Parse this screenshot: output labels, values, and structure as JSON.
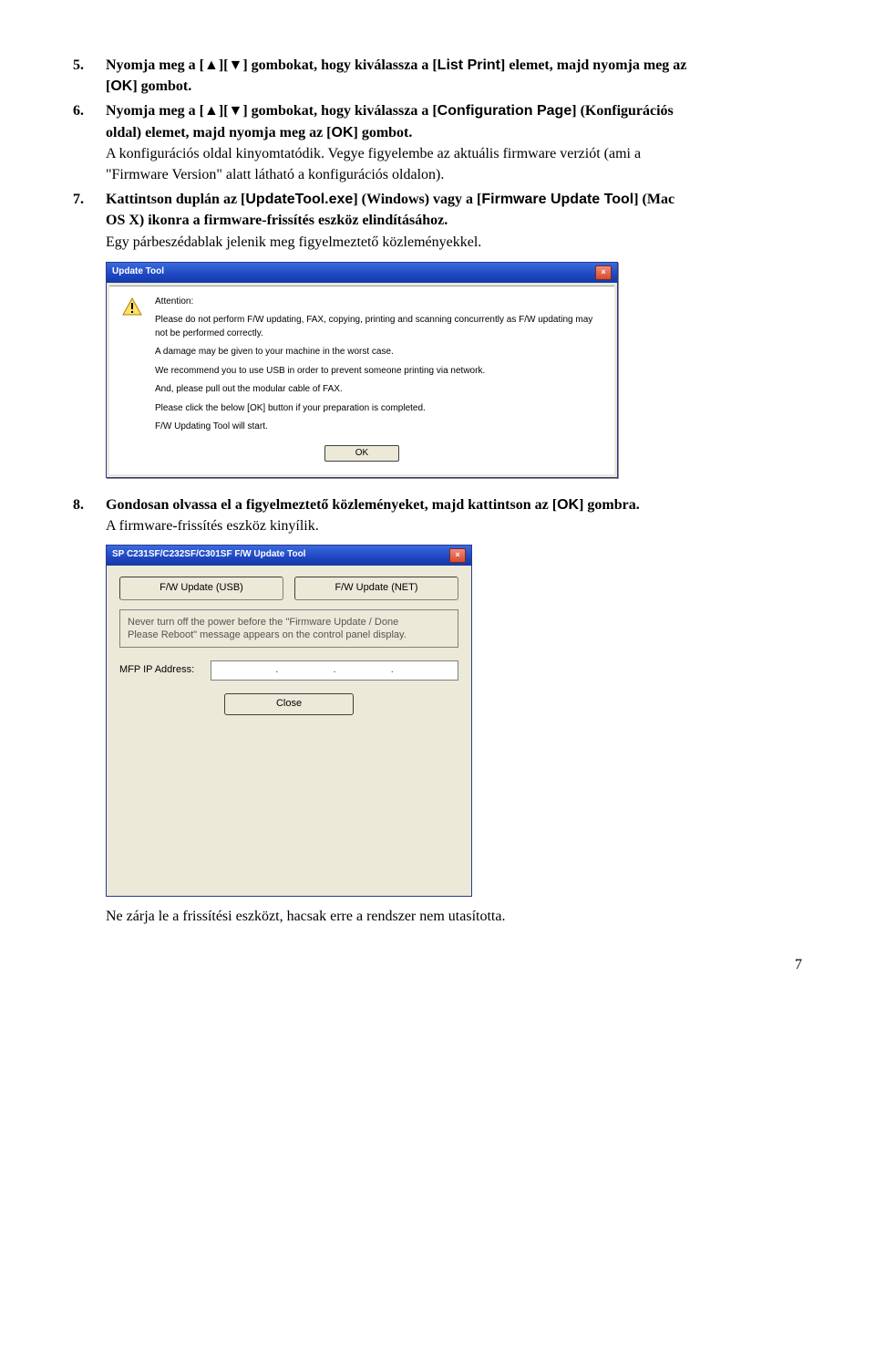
{
  "steps": {
    "s5": {
      "num": "5.",
      "pre": "Nyomja meg a [",
      "up": "▲",
      "mid1": "][",
      "down": "▼",
      "mid2": "] gombokat, hogy kiválassza a [",
      "listprint": "List Print",
      "mid3": "] elemet, majd nyomja meg az",
      "line2a": "[",
      "ok": "OK",
      "line2b": "] gombot."
    },
    "s6": {
      "num": "6.",
      "pre": "Nyomja meg a [",
      "up": "▲",
      "mid1": "][",
      "down": "▼",
      "mid2": "] gombokat, hogy kiválassza a [",
      "cfg": "Configuration Page",
      "mid3": "] (Konfigurációs",
      "line2a": "oldal) elemet, majd nyomja meg az [",
      "ok": "OK",
      "line2b": "] gombot.",
      "p1": "A konfigurációs oldal kinyomtatódik. Vegye figyelembe az aktuális firmware verziót (ami a",
      "p2": "\"Firmware Version\" alatt látható a konfigurációs oldalon)."
    },
    "s7": {
      "num": "7.",
      "pre": "Kattintson duplán az [",
      "exe": "UpdateTool.exe",
      "mid1": "] (Windows) vagy a [",
      "tool": "Firmware Update Tool",
      "mid2": "] (Mac",
      "line2": "OS X) ikonra a firmware-frissítés eszköz elindításához.",
      "p1": "Egy párbeszédablak jelenik meg figyelmeztető közleményekkel."
    },
    "s8": {
      "num": "8.",
      "pre": "Gondosan olvassa el a figyelmeztető közleményeket, majd kattintson az [",
      "ok": "OK",
      "post": "] gombra.",
      "p1": "A firmware-frissítés eszköz kinyílik."
    }
  },
  "dialog1": {
    "title": "Update Tool",
    "close_x": "×",
    "attention": "Attention:",
    "m1": "Please do not perform F/W updating, FAX, copying, printing and scanning concurrently as F/W updating may not be performed correctly.",
    "m2": "A damage may be given to your machine in the worst case.",
    "m3": "We recommend you to use USB in order to prevent someone printing via network.",
    "m4": "And, please pull out the modular cable of FAX.",
    "m5": "Please click the below [OK] button if your preparation is completed.",
    "m6": "F/W Updating Tool will start.",
    "ok": "OK"
  },
  "dialog2": {
    "title": "SP C231SF/C232SF/C301SF F/W Update Tool",
    "close_x": "×",
    "btn_usb": "F/W Update (USB)",
    "btn_net": "F/W Update (NET)",
    "notice1": "Never turn off the power before the \"Firmware Update / Done",
    "notice2": "Please Reboot\" message appears on the control panel display.",
    "ip_label": "MFP IP Address:",
    "dot": ".",
    "close": "Close"
  },
  "footer": {
    "note": "Ne zárja le a frissítési eszközt, hacsak erre a rendszer nem utasította.",
    "pagenum": "7"
  }
}
